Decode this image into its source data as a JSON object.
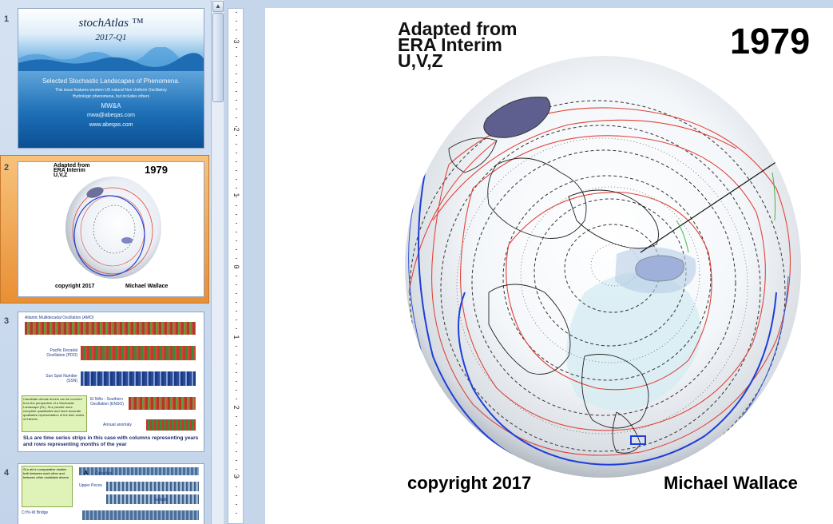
{
  "thumbnails": [
    {
      "number": "1",
      "title": "stochAtlas ™",
      "subtitle": "2017-Q1",
      "heading": "Selected Stochastic Landscapes of Phenomena.",
      "line1": "This issue features western US natural Non Uniform Oscillatory",
      "line2": "Hydrologic phenomena, but includes others",
      "org": "MW&A",
      "email": "mwa@abeqas.com",
      "site": "www.abeqas.com"
    },
    {
      "number": "2",
      "header_lines": [
        "Adapted from",
        "ERA Interim",
        "U,V,Z"
      ],
      "year": "1979",
      "copyright": "copyright 2017",
      "author": "Michael Wallace"
    },
    {
      "number": "3",
      "amo_label": "Atlantic Multidecadal Oscillation (AMO)",
      "pdo_label": "Pacific Decadal Oscillation (PDO)",
      "ssn_label": "Sun Spot Number (SSN)",
      "enso_label": "El Niño - Southern Oscillation (ENSO)",
      "annual_label": "Annual anomaly",
      "box_text": "Candidate climate drivers can be covered from the perspective of a Stochastic Landscape (SL). SLs provide more complete quantitative and more accurate qualitative representation of the time series of interest.",
      "caption": "SLs are time series strips in this case with columns representing years and rows representing months of the year"
    },
    {
      "number": "4",
      "note": "SLs aid in comparative studies both between each other and between other candidate drivers.",
      "box_letter": "A",
      "canadian": "Canadian",
      "upper_pecos": "Upper Pecos",
      "gallatin": "Gallatin",
      "bridge": "CrYo-W Bridge"
    }
  ],
  "slide": {
    "header_lines": [
      "Adapted from",
      "ERA Interim",
      "U,V,Z"
    ],
    "year": "1979",
    "copyright": "copyright 2017",
    "author": "Michael Wallace"
  },
  "ruler": {
    "labels": [
      "3",
      "2",
      "1",
      "0",
      "1",
      "2",
      "3"
    ]
  },
  "colors": {
    "selection": "#e88f34",
    "panel": "#c5d5ea",
    "contour_red": "#e0443a",
    "contour_blue": "#1e3fd8"
  }
}
